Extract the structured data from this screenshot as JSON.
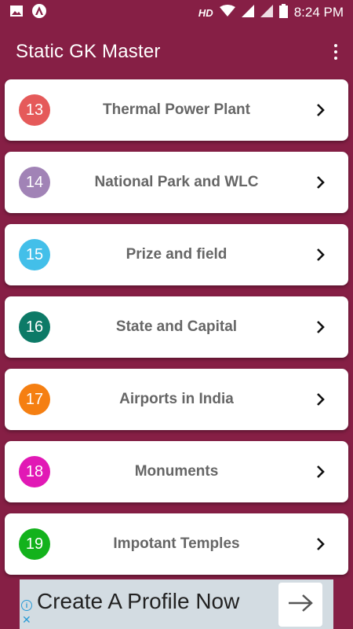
{
  "status_bar": {
    "network_label": "HD",
    "time": "8:24 PM"
  },
  "app_bar": {
    "title": "Static GK Master",
    "menu_icon": "more-vert-icon"
  },
  "items": [
    {
      "number": "13",
      "label": "Thermal Power Plant",
      "color": "#e55a5a"
    },
    {
      "number": "14",
      "label": "National Park and WLC",
      "color": "#a183b6"
    },
    {
      "number": "15",
      "label": "Prize and field",
      "color": "#43bfe9"
    },
    {
      "number": "16",
      "label": "State and Capital",
      "color": "#0d7a67"
    },
    {
      "number": "17",
      "label": "Airports in India",
      "color": "#f57f12"
    },
    {
      "number": "18",
      "label": "Monuments",
      "color": "#e119b5"
    },
    {
      "number": "19",
      "label": "Impotant Temples",
      "color": "#13b21c"
    }
  ],
  "ad": {
    "text": "Create A Profile Now",
    "info_icon": "info-icon",
    "close_icon": "close-icon",
    "arrow_icon": "arrow-right-icon"
  },
  "colors": {
    "background": "#861f45",
    "card": "#ffffff",
    "label_text": "#666666"
  }
}
